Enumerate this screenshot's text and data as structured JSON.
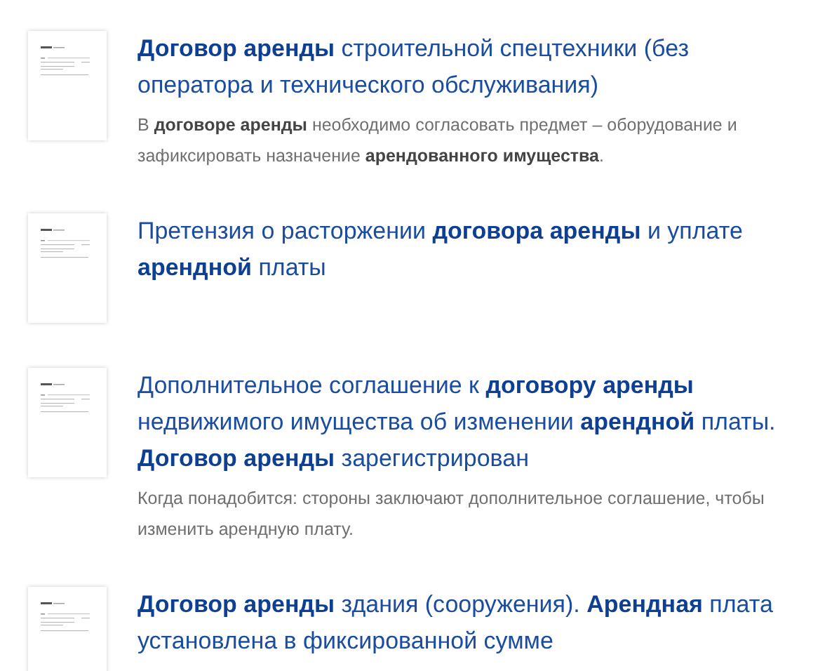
{
  "documents": [
    {
      "title": "**Договор аренды** строительной спецтехники (без оператора и технического обслуживания)",
      "description": "В **договоре аренды** необходимо согласовать предмет – оборудование и зафиксировать назначение **арендованного имущества**."
    },
    {
      "title": "Претензия о расторжении **договора аренды** и уплате **арендной** платы"
    },
    {
      "title": "Дополнительное соглашение к **договору аренды** недвижимого имущества об изменении **арендной** платы. **Договор аренды** зарегистрирован",
      "description": "Когда понадобится: стороны заключают дополнительное соглашение, чтобы изменить арендную плату."
    },
    {
      "title": "**Договор аренды** здания (сооружения). **Арендная** плата установлена в фиксированной сумме"
    }
  ]
}
